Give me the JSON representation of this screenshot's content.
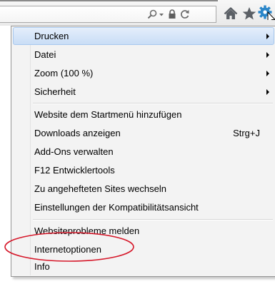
{
  "toolbar": {
    "address_icons": [
      "search-icon",
      "dropdown-arrow-icon",
      "lock-icon",
      "refresh-icon"
    ],
    "buttons": [
      "home-icon",
      "favorites-star-icon",
      "tools-gear-icon"
    ]
  },
  "menu": {
    "items": [
      {
        "label": "Drucken",
        "submenu": true,
        "highlighted": true
      },
      {
        "label": "Datei",
        "submenu": true
      },
      {
        "label": "Zoom (100 %)",
        "submenu": true
      },
      {
        "label": "Sicherheit",
        "submenu": true
      },
      {
        "label": "Website dem Startmenü hinzufügen"
      },
      {
        "label": "Downloads anzeigen",
        "shortcut": "Strg+J"
      },
      {
        "label": "Add-Ons verwalten"
      },
      {
        "label": "F12 Entwicklertools"
      },
      {
        "label": "Zu angehefteten Sites wechseln"
      },
      {
        "label": "Einstellungen der Kompatibilitätsansicht"
      },
      {
        "label": "Websiteprobleme melden"
      },
      {
        "label": "Internetoptionen",
        "annotated": true
      },
      {
        "label": "Info"
      }
    ]
  },
  "colors": {
    "menu_background": "#f3f3f3",
    "highlight": "#c9ddf6",
    "annotation": "#d6182a",
    "gear_icon": "#2a86c9"
  }
}
